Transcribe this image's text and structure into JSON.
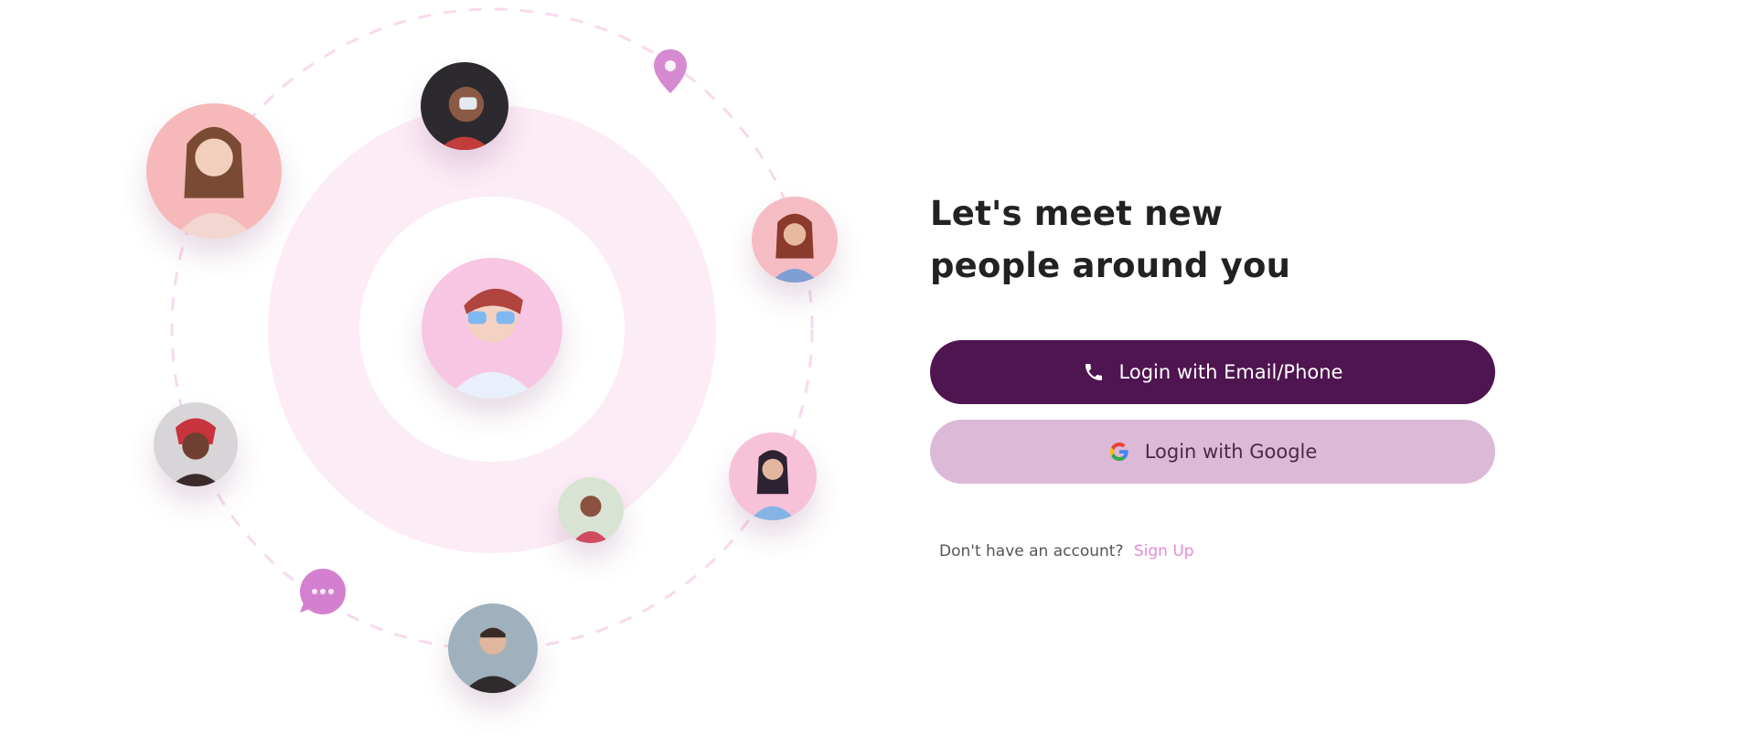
{
  "headline": {
    "line1": "Let's meet new",
    "line2": "people around you"
  },
  "buttons": {
    "email_label": "Login with Email/Phone",
    "email_icon": "phone-icon",
    "google_label": "Login with Google",
    "google_icon": "google-logo-icon"
  },
  "signup": {
    "prompt": "Don't have an account?",
    "link_label": "Sign Up"
  },
  "colors": {
    "primary": "#4f1550",
    "secondary": "#dcb9d6",
    "accent": "#e58ad8",
    "ring": "#fbeaf5"
  },
  "illustration": {
    "icons": [
      "location-pin-icon",
      "chat-bubble-icon"
    ],
    "avatars": [
      "woman-avatar",
      "man-avatar",
      "user-avatar"
    ]
  }
}
